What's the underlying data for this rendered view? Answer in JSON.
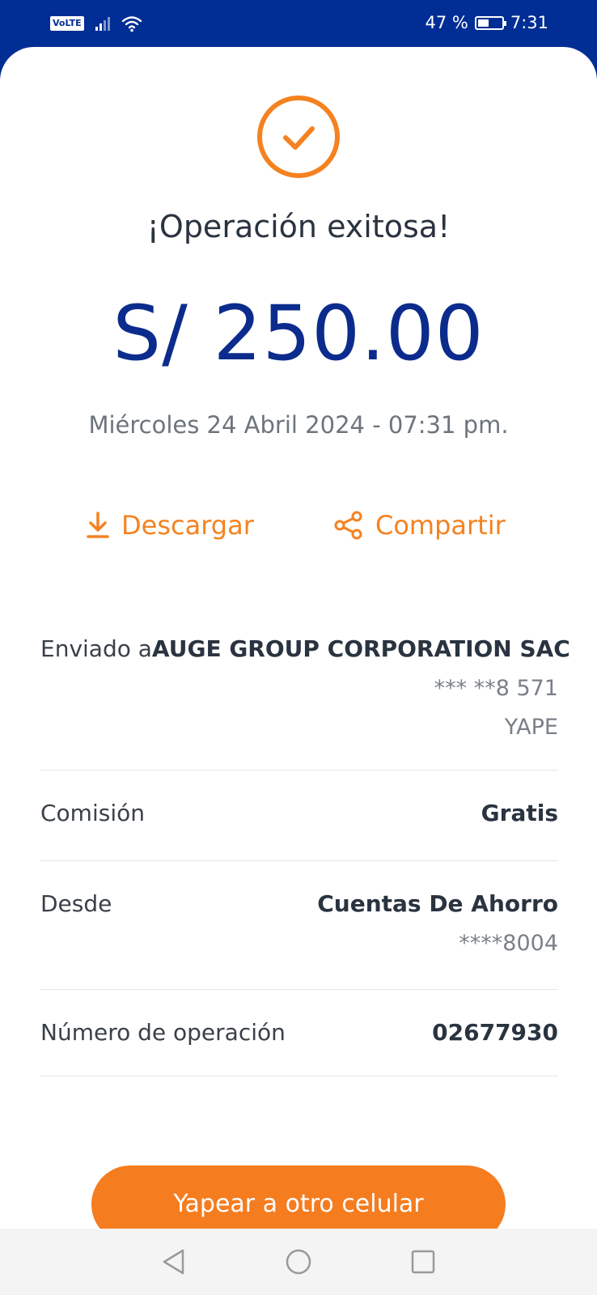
{
  "status_bar": {
    "volte": "VoLTE",
    "battery": "47 %",
    "battery_level": 0.47,
    "time": "7:31"
  },
  "receipt": {
    "title": "¡Operación exitosa!",
    "amount": "S/ 250.00",
    "datetime": "Miércoles 24 Abril 2024 - 07:31 pm.",
    "icon": "check-circle-icon"
  },
  "actions": {
    "download_label": "Descargar",
    "share_label": "Compartir"
  },
  "details": {
    "sent_label": "Enviado a",
    "recipient": "AUGE GROUP CORPORATION SAC",
    "recipient_phone": "*** **8 571",
    "recipient_app": "YAPE",
    "commission_label": "Comisión",
    "commission_value": "Gratis",
    "from_label": "Desde",
    "from_account": "Cuentas De Ahorro",
    "from_number": "****8004",
    "operation_label": "Número de operación",
    "operation_number": "02677930"
  },
  "cta": {
    "label": "Yapear a otro celular"
  },
  "colors": {
    "brand_blue": "#002e95",
    "accent_orange": "#f58220",
    "amount_blue": "#0b2c8c"
  }
}
